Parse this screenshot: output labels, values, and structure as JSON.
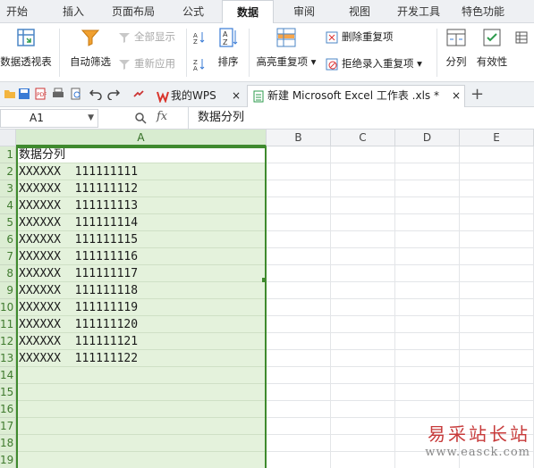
{
  "menu_tabs": [
    "开始",
    "插入",
    "页面布局",
    "公式",
    "数据",
    "审阅",
    "视图",
    "开发工具",
    "特色功能"
  ],
  "active_tab": "数据",
  "ribbon": {
    "pivot": "数据透视表",
    "autofilter": "自动筛选",
    "show_all": "全部显示",
    "reapply": "重新应用",
    "sort": "排序",
    "highlight_dup": "高亮重复项",
    "delete_dup": "删除重复项",
    "reject_dup": "拒绝录入重复项",
    "split": "分列",
    "validity": "有效性"
  },
  "doc_tabs": {
    "wps_tab": "我的WPS",
    "file_tab": "新建 Microsoft Excel 工作表 .xls *",
    "add": "+"
  },
  "formula_bar": {
    "name_box": "A1",
    "fx": "fx",
    "content": "数据分列"
  },
  "sheet": {
    "columns": [
      "A",
      "B",
      "C",
      "D",
      "E"
    ],
    "rows": [
      "1",
      "2",
      "3",
      "4",
      "5",
      "6",
      "7",
      "8",
      "9",
      "10",
      "11",
      "12",
      "13",
      "14",
      "15",
      "16",
      "17",
      "18",
      "19"
    ],
    "col_a_values": [
      "数据分列",
      "XXXXXX  111111111",
      "XXXXXX  111111112",
      "XXXXXX  111111113",
      "XXXXXX  111111114",
      "XXXXXX  111111115",
      "XXXXXX  111111116",
      "XXXXXX  111111117",
      "XXXXXX  111111118",
      "XXXXXX  111111119",
      "XXXXXX  111111120",
      "XXXXXX  111111121",
      "XXXXXX  111111122"
    ]
  },
  "watermark": {
    "cn": "易采站长站",
    "en": "www.easck.com"
  },
  "colors": {
    "accent_green": "#3f8a2e",
    "selected_fill": "#e4f2dc",
    "wps_red": "#d9342b"
  }
}
